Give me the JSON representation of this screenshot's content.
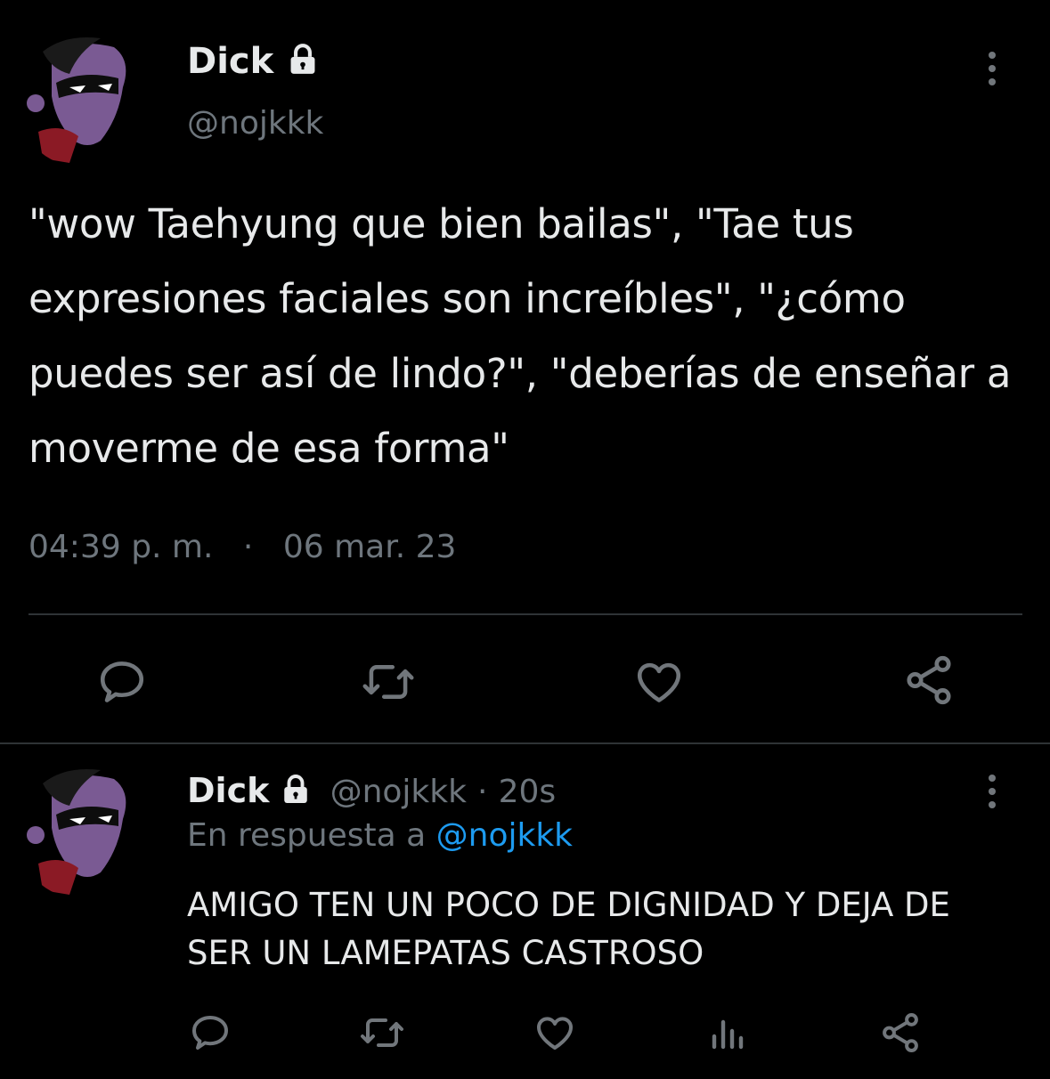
{
  "main_tweet": {
    "display_name": "Dick",
    "handle": "@nojkkk",
    "text": "\"wow Taehyung que bien bailas\", \"Tae tus expresiones faciales son increíbles\", \"¿cómo puedes ser así de lindo?\", \"deberías de enseñar a moverme de esa forma\"",
    "time": "04:39 p. m.",
    "separator": "·",
    "date": "06 mar. 23",
    "icons": [
      "reply-icon",
      "retweet-icon",
      "like-icon",
      "share-icon"
    ]
  },
  "reply_tweet": {
    "display_name": "Dick",
    "handle": "@nojkkk",
    "separator": "·",
    "age": "20s",
    "reply_prefix": "En respuesta a",
    "reply_to": "@nojkkk",
    "text": "AMIGO TEN UN POCO DE DIGNIDAD Y DEJA DE SER UN LAMEPATAS CASTROSO",
    "icons": [
      "reply-icon",
      "retweet-icon",
      "like-icon",
      "views-icon",
      "share-icon"
    ]
  },
  "colors": {
    "background": "#000000",
    "text": "#e7e9ea",
    "muted": "#6e767d",
    "link": "#1d9bf0",
    "divider": "#2f3336"
  }
}
